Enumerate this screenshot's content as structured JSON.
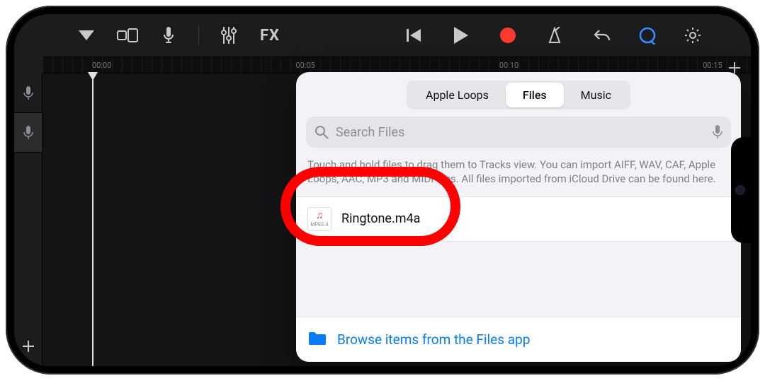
{
  "toolbar": {
    "fx_label": "FX"
  },
  "ruler": {
    "marks": [
      "00:00",
      "00:05",
      "00:10",
      "00:15"
    ]
  },
  "popover": {
    "segments": {
      "apple_loops": "Apple Loops",
      "files": "Files",
      "music": "Music",
      "active": "files"
    },
    "search": {
      "placeholder": "Search Files"
    },
    "hint": "Touch and hold files to drag them to Tracks view. You can import AIFF, WAV, CAF, Apple Loops, AAC, MP3 and MIDI files. All files imported from iCloud Drive can be found here.",
    "files": [
      {
        "name": "Ringtone.m4a",
        "badge": "MPEG 4"
      }
    ],
    "browse_label": "Browse items from the Files app"
  }
}
